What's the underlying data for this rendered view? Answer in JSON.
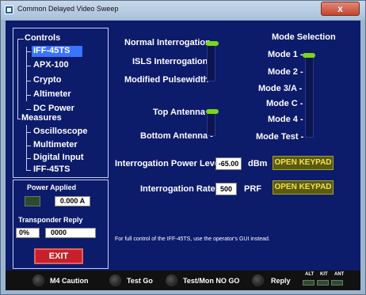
{
  "window": {
    "title": "Common Delayed Video Sweep",
    "close_label": "x"
  },
  "sidebar": {
    "controls_label": "Controls",
    "controls": [
      "IFF-45TS",
      "APX-100",
      "Crypto",
      "Altimeter",
      "DC Power"
    ],
    "measures_label": "Measures",
    "measures": [
      "Oscilloscope",
      "Multimeter",
      "Digital Input",
      "IFF-45TS"
    ],
    "selected": "IFF-45TS"
  },
  "status": {
    "power_label": "Power Applied",
    "power_value": "0.000 A",
    "reply_label": "Transponder Reply",
    "reply_percent": "0%",
    "reply_count": "0000",
    "exit_label": "EXIT"
  },
  "interrogation": {
    "options": [
      "Normal Interrogation",
      "ISLS Interrogation",
      "Modified Pulsewidth"
    ],
    "selected": "Normal Interrogation"
  },
  "antenna": {
    "options": [
      "Top Antenna",
      "Bottom Antenna"
    ],
    "selected": "Top Antenna"
  },
  "mode_selection": {
    "title": "Mode Selection",
    "options": [
      "Mode 1",
      "Mode 2",
      "Mode 3/A",
      "Mode C",
      "Mode 4",
      "Mode Test"
    ],
    "selected": "Mode 1"
  },
  "power_level": {
    "label": "Interrogation Power Level",
    "value": "-65.00",
    "unit": "dBm",
    "button": "OPEN KEYPAD"
  },
  "rate": {
    "label": "Interrogation Rate",
    "value": "500",
    "unit": "PRF",
    "button": "OPEN KEYPAD"
  },
  "note": "For full control of the IFF-45TS, use the operator's GUI instead.",
  "indicators": {
    "m4_caution": "M4 Caution",
    "test_go": "Test Go",
    "test_nogo": "Test/Mon NO GO",
    "reply": "Reply",
    "alt": "ALT",
    "kit": "KIT",
    "ant": "ANT"
  },
  "colors": {
    "background": "#0d1b6b",
    "accent_green": "#7ad61c",
    "keypad_text": "#f4e04a",
    "exit_red": "#c8202a",
    "selection": "#3a74ff"
  }
}
